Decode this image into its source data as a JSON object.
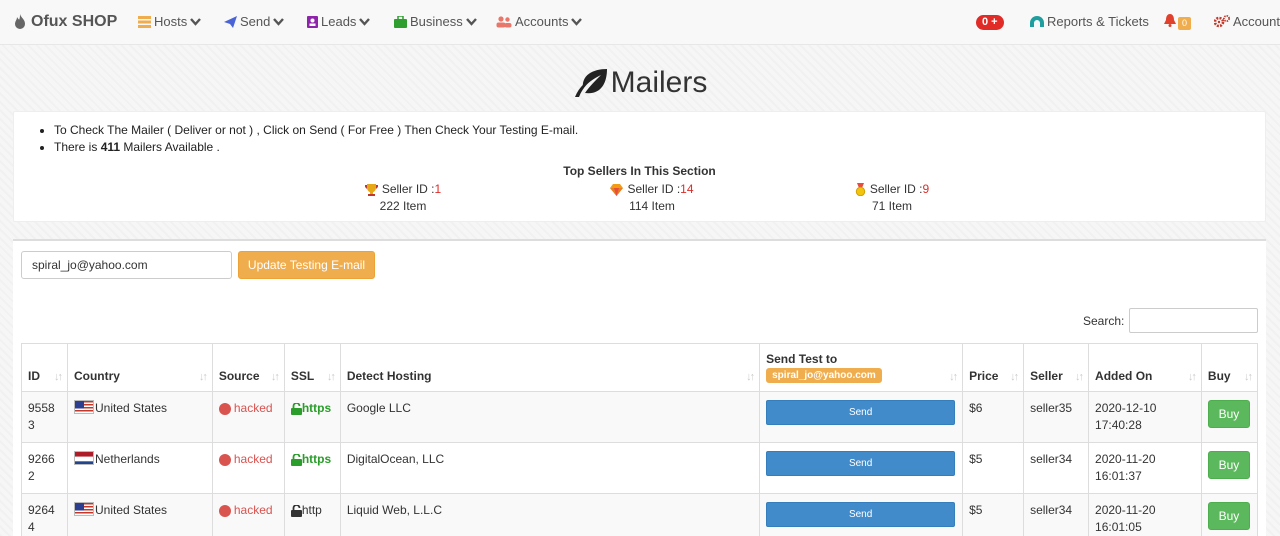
{
  "navbar": {
    "brand": "Ofux SHOP",
    "items": [
      {
        "label": "Hosts",
        "icon": "server-icon"
      },
      {
        "label": "Send",
        "icon": "paper-plane-icon"
      },
      {
        "label": "Leads",
        "icon": "address-book-icon"
      },
      {
        "label": "Business",
        "icon": "briefcase-icon"
      },
      {
        "label": "Accounts",
        "icon": "users-icon"
      }
    ],
    "cart_badge": "0",
    "reports_label": "Reports & Tickets",
    "notif_count": "0",
    "account_label": "Account"
  },
  "page": {
    "title": "Mailers"
  },
  "info": {
    "line1": "To Check The Mailer ( Deliver or not ) , Click on Send ( For Free ) Then Check Your Testing E-mail.",
    "line2_prefix": "There is ",
    "count": "411",
    "line2_suffix": " Mailers Available ."
  },
  "top_sellers": {
    "title": "Top Sellers In This Section",
    "sellers": [
      {
        "label": "Seller ID : ",
        "id": "1",
        "items": "222 Item"
      },
      {
        "label": "Seller ID : ",
        "id": "14",
        "items": "114 Item"
      },
      {
        "label": "Seller ID : ",
        "id": "9",
        "items": "71 Item"
      }
    ]
  },
  "controls": {
    "email_value": "spiral_jo@yahoo.com",
    "update_label": "Update Testing E-mail",
    "search_label": "Search:"
  },
  "table": {
    "headers": [
      "ID",
      "Country",
      "Source",
      "SSL",
      "Detect Hosting",
      "Send Test to",
      "Price",
      "Seller",
      "Added On",
      "Buy"
    ],
    "header_email": "spiral_jo@yahoo.com",
    "rows": [
      {
        "id": "95583",
        "country": "United States",
        "source": "hacked",
        "ssl": "https",
        "hosting": "Google LLC",
        "send": "Send",
        "price": "$6",
        "seller": "seller35",
        "added": "2020-12-10 17:40:28",
        "buy": "Buy"
      },
      {
        "id": "92662",
        "country": "Netherlands",
        "source": "hacked",
        "ssl": "https",
        "hosting": "DigitalOcean, LLC",
        "send": "Send",
        "price": "$5",
        "seller": "seller34",
        "added": "2020-11-20 16:01:37",
        "buy": "Buy"
      },
      {
        "id": "92644",
        "country": "United States",
        "source": "hacked",
        "ssl": "http",
        "hosting": "Liquid Web, L.L.C",
        "send": "Send",
        "price": "$5",
        "seller": "seller34",
        "added": "2020-11-20 16:01:05",
        "buy": "Buy"
      }
    ]
  },
  "colors": {
    "accent": "#f0ad4e",
    "primary": "#428bca",
    "success": "#5cb85c",
    "danger": "#d9534f"
  }
}
